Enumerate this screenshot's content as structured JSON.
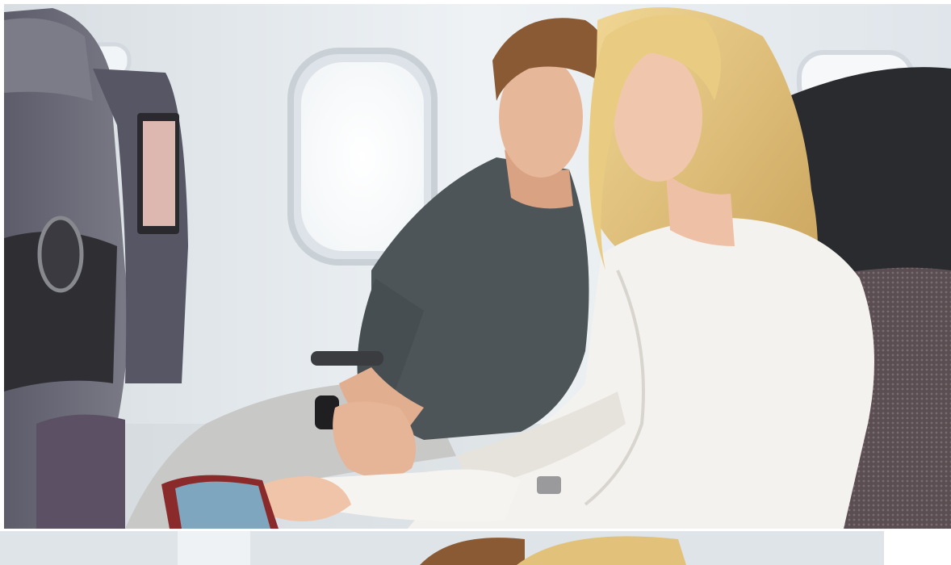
{
  "image": {
    "subject": "couple-in-airplane-seat-with-tablet",
    "colors": {
      "cabin_wall": "#e3e9ee",
      "window_glow": "#ffffff",
      "seat_fabric": "#6b6b78",
      "seat_dark": "#2b2b2e",
      "man_shirt": "#4e5558",
      "woman_blouse": "#f4f2ee",
      "hair_blonde": "#e2c27a",
      "hair_brown": "#8a5a34",
      "skin": "#e7b79a",
      "tablet": "#8a2a2a"
    }
  }
}
